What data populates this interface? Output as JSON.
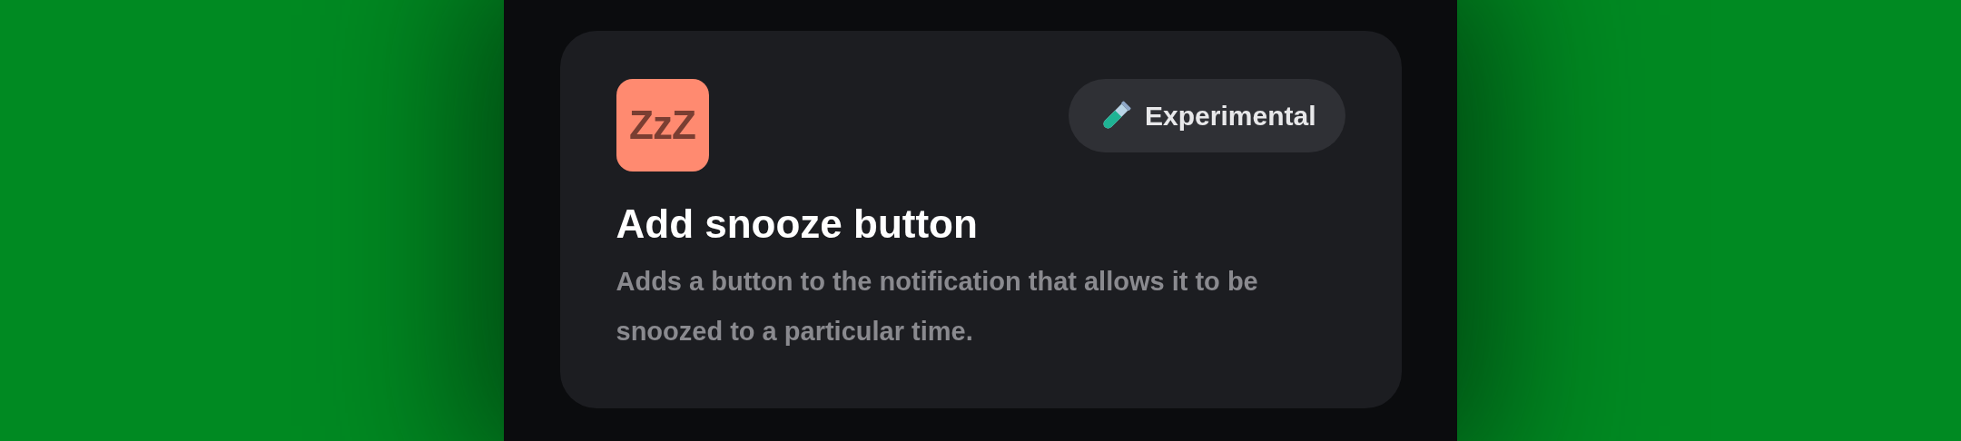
{
  "card": {
    "icon_text": "ZzZ",
    "badge": "Experimental",
    "title": "Add snooze button",
    "description": "Adds a button to the notification that allows it to be snoozed to a particular time."
  }
}
